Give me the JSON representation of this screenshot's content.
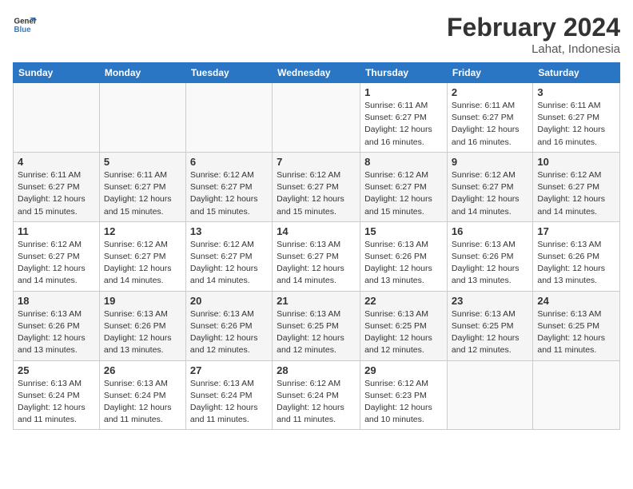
{
  "header": {
    "logo_line1": "General",
    "logo_line2": "Blue",
    "month_year": "February 2024",
    "location": "Lahat, Indonesia"
  },
  "weekdays": [
    "Sunday",
    "Monday",
    "Tuesday",
    "Wednesday",
    "Thursday",
    "Friday",
    "Saturday"
  ],
  "weeks": [
    [
      {
        "day": "",
        "info": ""
      },
      {
        "day": "",
        "info": ""
      },
      {
        "day": "",
        "info": ""
      },
      {
        "day": "",
        "info": ""
      },
      {
        "day": "1",
        "info": "Sunrise: 6:11 AM\nSunset: 6:27 PM\nDaylight: 12 hours\nand 16 minutes."
      },
      {
        "day": "2",
        "info": "Sunrise: 6:11 AM\nSunset: 6:27 PM\nDaylight: 12 hours\nand 16 minutes."
      },
      {
        "day": "3",
        "info": "Sunrise: 6:11 AM\nSunset: 6:27 PM\nDaylight: 12 hours\nand 16 minutes."
      }
    ],
    [
      {
        "day": "4",
        "info": "Sunrise: 6:11 AM\nSunset: 6:27 PM\nDaylight: 12 hours\nand 15 minutes."
      },
      {
        "day": "5",
        "info": "Sunrise: 6:11 AM\nSunset: 6:27 PM\nDaylight: 12 hours\nand 15 minutes."
      },
      {
        "day": "6",
        "info": "Sunrise: 6:12 AM\nSunset: 6:27 PM\nDaylight: 12 hours\nand 15 minutes."
      },
      {
        "day": "7",
        "info": "Sunrise: 6:12 AM\nSunset: 6:27 PM\nDaylight: 12 hours\nand 15 minutes."
      },
      {
        "day": "8",
        "info": "Sunrise: 6:12 AM\nSunset: 6:27 PM\nDaylight: 12 hours\nand 15 minutes."
      },
      {
        "day": "9",
        "info": "Sunrise: 6:12 AM\nSunset: 6:27 PM\nDaylight: 12 hours\nand 14 minutes."
      },
      {
        "day": "10",
        "info": "Sunrise: 6:12 AM\nSunset: 6:27 PM\nDaylight: 12 hours\nand 14 minutes."
      }
    ],
    [
      {
        "day": "11",
        "info": "Sunrise: 6:12 AM\nSunset: 6:27 PM\nDaylight: 12 hours\nand 14 minutes."
      },
      {
        "day": "12",
        "info": "Sunrise: 6:12 AM\nSunset: 6:27 PM\nDaylight: 12 hours\nand 14 minutes."
      },
      {
        "day": "13",
        "info": "Sunrise: 6:12 AM\nSunset: 6:27 PM\nDaylight: 12 hours\nand 14 minutes."
      },
      {
        "day": "14",
        "info": "Sunrise: 6:13 AM\nSunset: 6:27 PM\nDaylight: 12 hours\nand 14 minutes."
      },
      {
        "day": "15",
        "info": "Sunrise: 6:13 AM\nSunset: 6:26 PM\nDaylight: 12 hours\nand 13 minutes."
      },
      {
        "day": "16",
        "info": "Sunrise: 6:13 AM\nSunset: 6:26 PM\nDaylight: 12 hours\nand 13 minutes."
      },
      {
        "day": "17",
        "info": "Sunrise: 6:13 AM\nSunset: 6:26 PM\nDaylight: 12 hours\nand 13 minutes."
      }
    ],
    [
      {
        "day": "18",
        "info": "Sunrise: 6:13 AM\nSunset: 6:26 PM\nDaylight: 12 hours\nand 13 minutes."
      },
      {
        "day": "19",
        "info": "Sunrise: 6:13 AM\nSunset: 6:26 PM\nDaylight: 12 hours\nand 13 minutes."
      },
      {
        "day": "20",
        "info": "Sunrise: 6:13 AM\nSunset: 6:26 PM\nDaylight: 12 hours\nand 12 minutes."
      },
      {
        "day": "21",
        "info": "Sunrise: 6:13 AM\nSunset: 6:25 PM\nDaylight: 12 hours\nand 12 minutes."
      },
      {
        "day": "22",
        "info": "Sunrise: 6:13 AM\nSunset: 6:25 PM\nDaylight: 12 hours\nand 12 minutes."
      },
      {
        "day": "23",
        "info": "Sunrise: 6:13 AM\nSunset: 6:25 PM\nDaylight: 12 hours\nand 12 minutes."
      },
      {
        "day": "24",
        "info": "Sunrise: 6:13 AM\nSunset: 6:25 PM\nDaylight: 12 hours\nand 11 minutes."
      }
    ],
    [
      {
        "day": "25",
        "info": "Sunrise: 6:13 AM\nSunset: 6:24 PM\nDaylight: 12 hours\nand 11 minutes."
      },
      {
        "day": "26",
        "info": "Sunrise: 6:13 AM\nSunset: 6:24 PM\nDaylight: 12 hours\nand 11 minutes."
      },
      {
        "day": "27",
        "info": "Sunrise: 6:13 AM\nSunset: 6:24 PM\nDaylight: 12 hours\nand 11 minutes."
      },
      {
        "day": "28",
        "info": "Sunrise: 6:12 AM\nSunset: 6:24 PM\nDaylight: 12 hours\nand 11 minutes."
      },
      {
        "day": "29",
        "info": "Sunrise: 6:12 AM\nSunset: 6:23 PM\nDaylight: 12 hours\nand 10 minutes."
      },
      {
        "day": "",
        "info": ""
      },
      {
        "day": "",
        "info": ""
      }
    ]
  ]
}
